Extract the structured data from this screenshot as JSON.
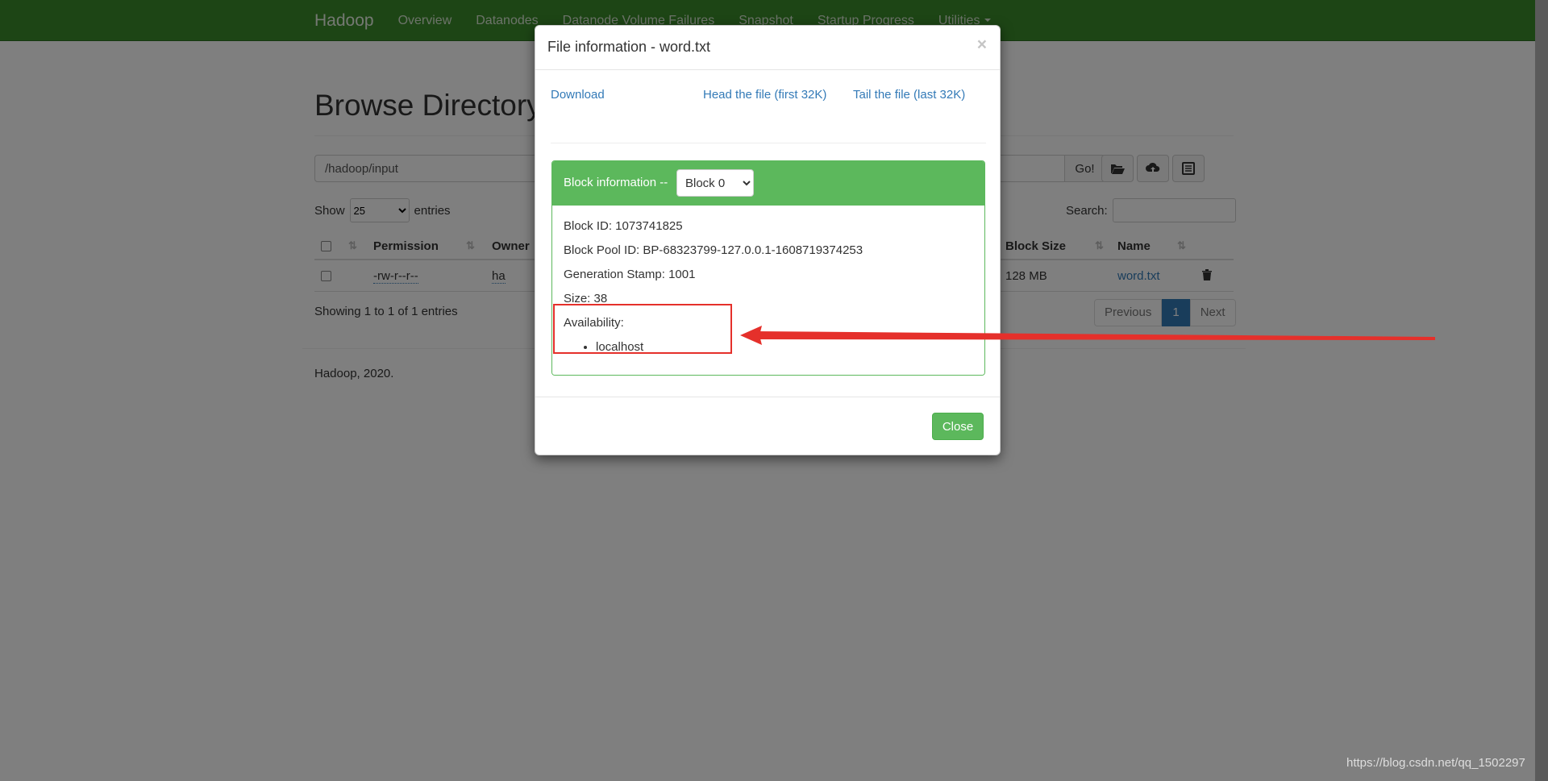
{
  "navbar": {
    "brand": "Hadoop",
    "links": [
      "Overview",
      "Datanodes",
      "Datanode Volume Failures",
      "Snapshot",
      "Startup Progress",
      "Utilities"
    ]
  },
  "page": {
    "title": "Browse Directory",
    "path_value": "/hadoop/input",
    "go_label": "Go!",
    "show_label": "Show",
    "entries_label": "entries",
    "page_length": "25",
    "search_label": "Search:",
    "search_value": ""
  },
  "table": {
    "headers": {
      "permission": "Permission",
      "owner": "Owner",
      "block_size": "Block Size",
      "name": "Name"
    },
    "row": {
      "permission": "-rw-r--r--",
      "owner": "ha",
      "block_size": "128 MB",
      "name": "word.txt"
    },
    "showing": "Showing 1 to 1 of 1 entries"
  },
  "pagination": {
    "previous": "Previous",
    "current": "1",
    "next": "Next"
  },
  "footer": {
    "text": "Hadoop, 2020."
  },
  "modal": {
    "title": "File information - word.txt",
    "close_glyph": "×",
    "download": "Download",
    "head": "Head the file (first 32K)",
    "tail": "Tail the file (last 32K)",
    "block_info_label": "Block information --",
    "block_selected": "Block 0",
    "block_id": "Block ID: 1073741825",
    "block_pool_id": "Block Pool ID: BP-68323799-127.0.0.1-1608719374253",
    "generation_stamp": "Generation Stamp: 1001",
    "size": "Size: 38",
    "availability": "Availability:",
    "availability_hosts": [
      "localhost"
    ],
    "close_button": "Close"
  },
  "annotation": {
    "color": "#e5302b"
  },
  "watermark": "https://blog.csdn.net/qq_1502297",
  "colors": {
    "navbar": "#3a8a2a",
    "panel": "#5cb85c",
    "link": "#337ab7"
  }
}
